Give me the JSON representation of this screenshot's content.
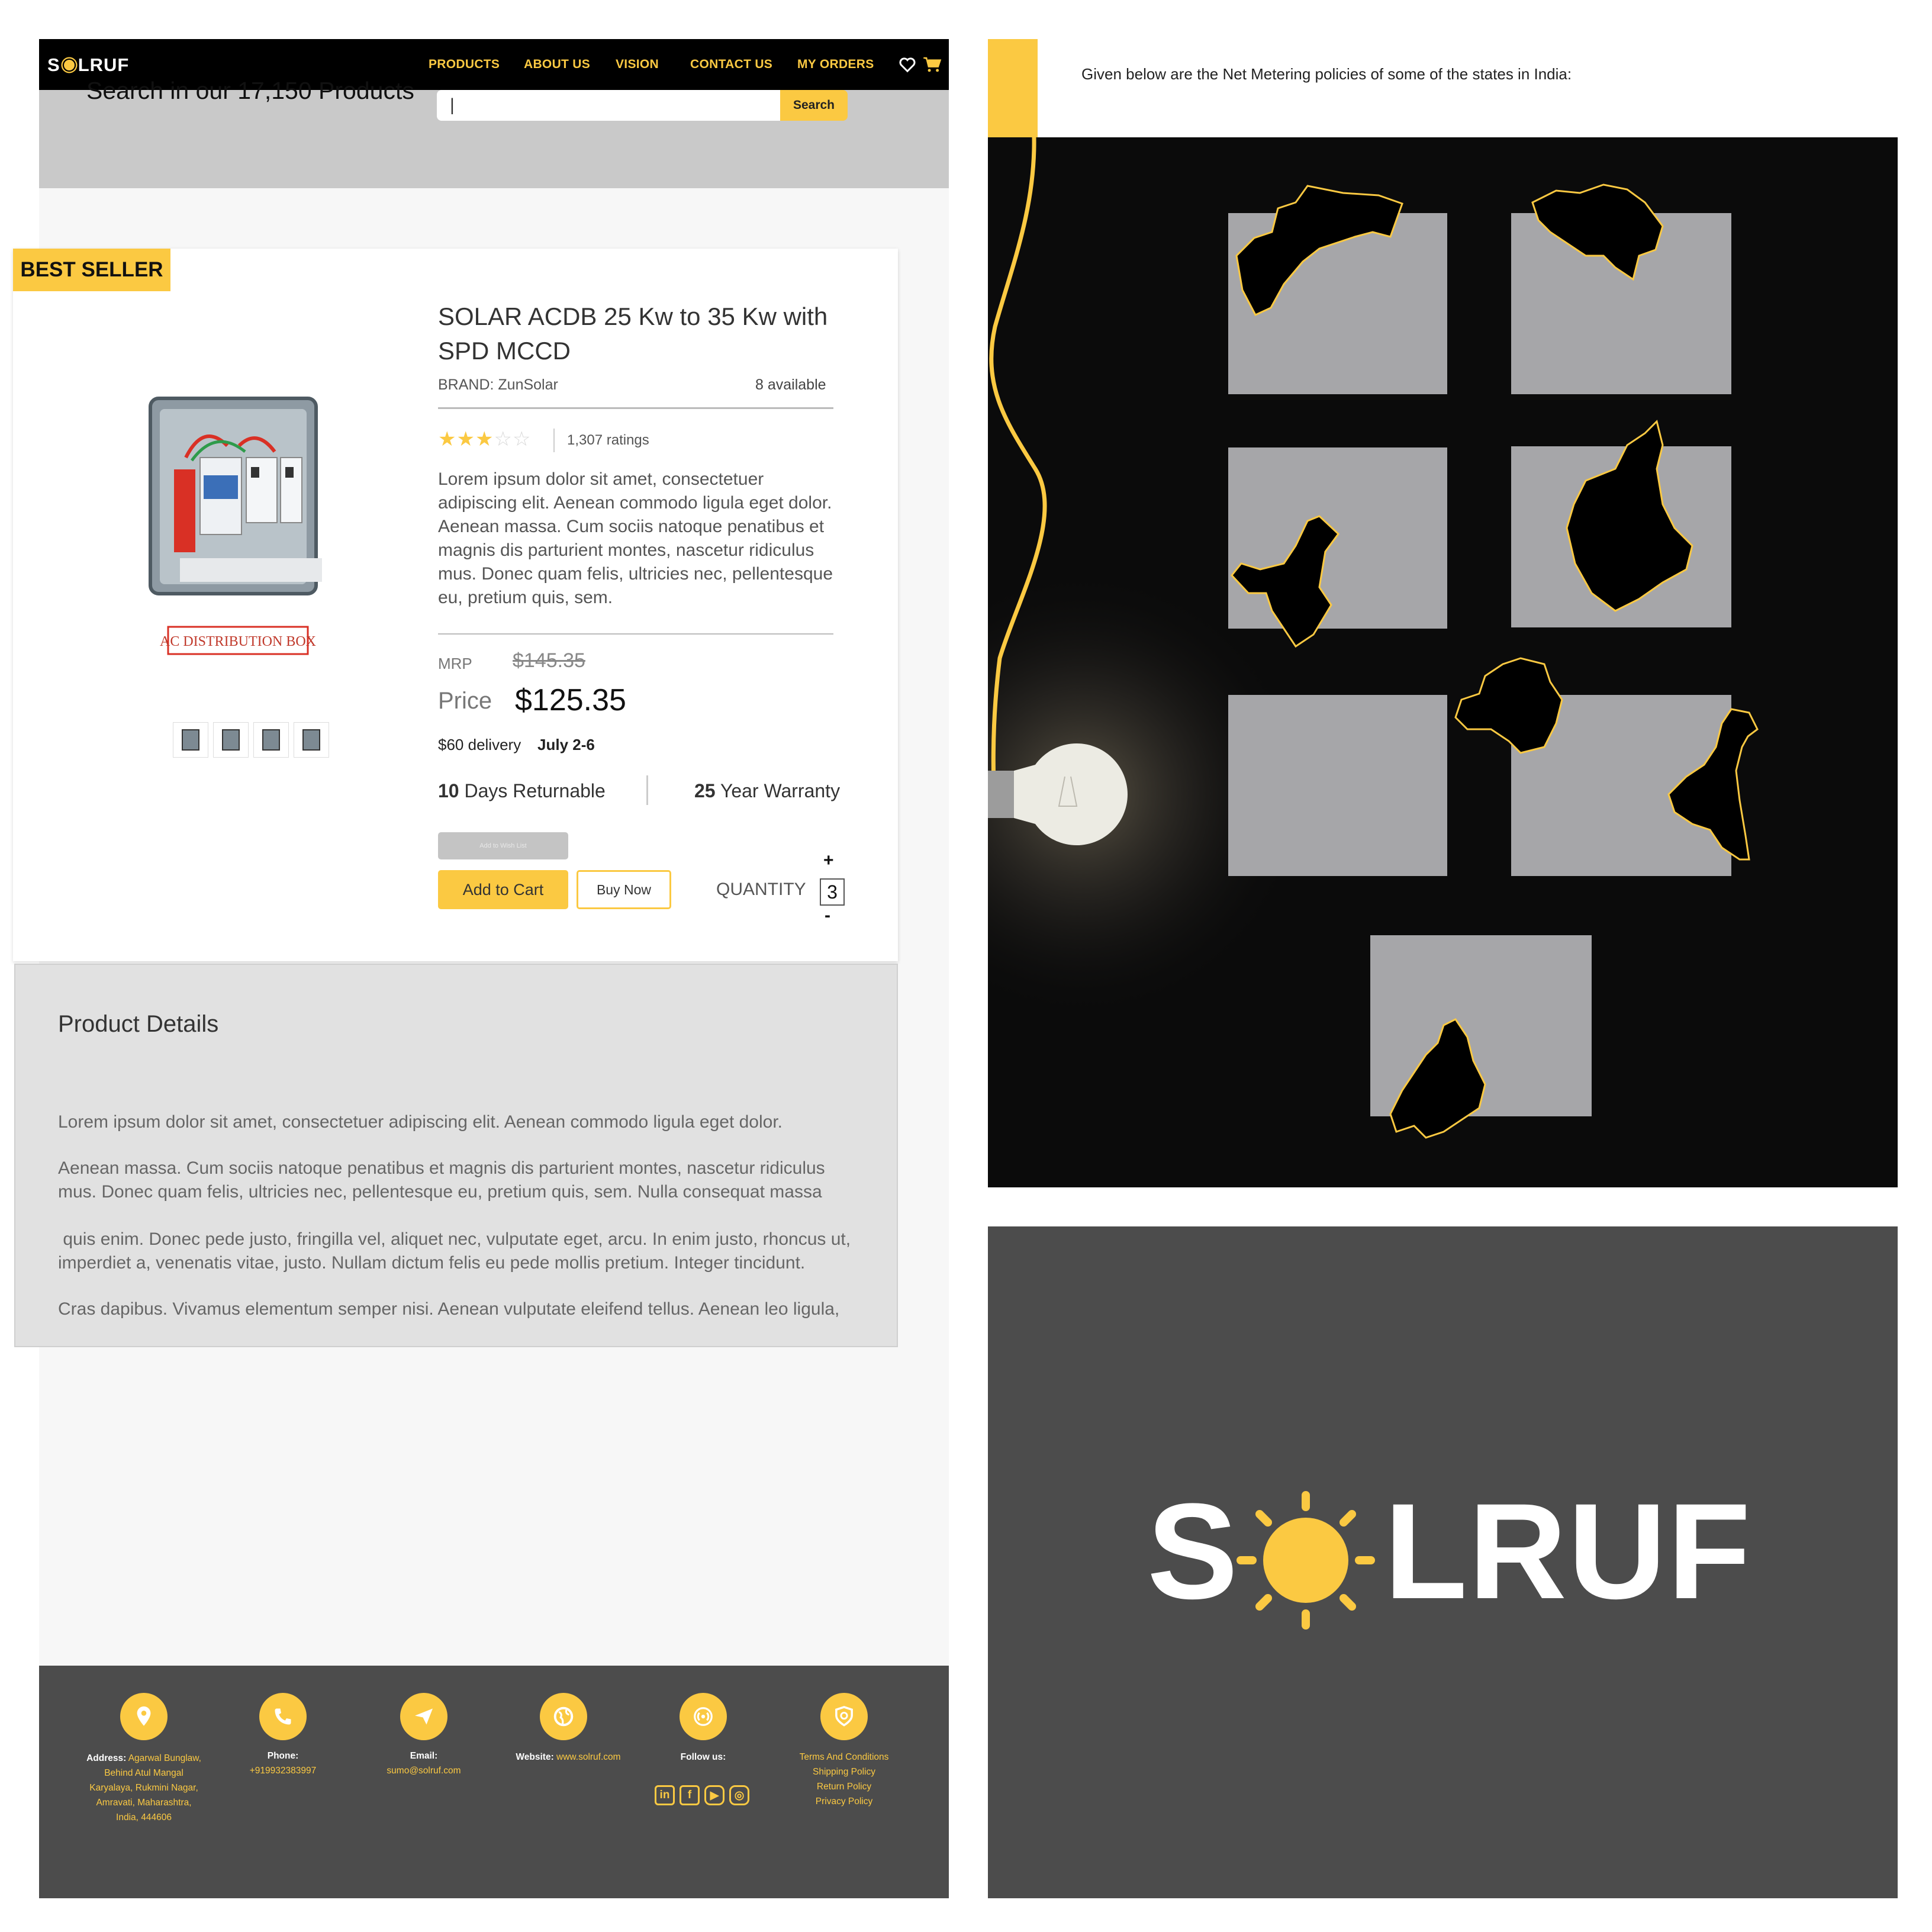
{
  "store": {
    "logo_text": "SOLRUF",
    "nav": [
      "PRODUCTS",
      "ABOUT US",
      "VISION",
      "CONTACT US",
      "MY ORDERS"
    ],
    "icons": [
      "heart-icon",
      "cart-icon"
    ],
    "search_heading": "Search in our 17,150 Products",
    "search_value": "|",
    "search_button": "Search",
    "badge": "BEST SELLER",
    "product": {
      "image_caption": "AC DISTRIBUTION BOX",
      "title": "SOLAR ACDB 25 Kw to 35 Kw with SPD MCCD",
      "brand": "BRAND: ZunSolar",
      "available": "8 available",
      "rating_stars": 3,
      "rating_max": 5,
      "ratings": "1,307 ratings",
      "description": "Lorem ipsum dolor sit amet, consectetuer adipiscing elit. Aenean commodo ligula eget dolor. Aenean massa. Cum sociis natoque penatibus et magnis dis parturient montes, nascetur ridiculus mus. Donec quam felis, ultricies nec, pellentesque eu, pretium quis, sem.",
      "mrp_label": "MRP",
      "mrp": "$145.35",
      "price_label": "Price",
      "price": "$125.35",
      "delivery": "$60 delivery",
      "delivery_date": "July 2-6",
      "return_days": "10",
      "return_text": " Days Returnable",
      "warranty_years": "25",
      "warranty_text": " Year Warranty",
      "wishlist_button": "Add to Wish List",
      "add_to_cart": "Add to Cart",
      "buy_now": "Buy Now",
      "quantity_label": "QUANTITY",
      "quantity": "3",
      "plus": "+",
      "minus": "-"
    },
    "details": {
      "title": "Product Details",
      "paragraphs": [
        "Lorem ipsum dolor sit amet, consectetuer adipiscing elit. Aenean commodo ligula eget dolor.",
        "Aenean massa. Cum sociis natoque penatibus et magnis dis parturient montes, nascetur ridiculus mus. Donec quam felis, ultricies nec, pellentesque eu, pretium quis, sem. Nulla consequat massa",
        " quis enim. Donec pede justo, fringilla vel, aliquet nec, vulputate eget, arcu. In enim justo, rhoncus ut, imperdiet a, venenatis vitae, justo. Nullam dictum felis eu pede mollis pretium. Integer tincidunt.",
        "Cras dapibus. Vivamus elementum semper nisi. Aenean vulputate eleifend tellus. Aenean leo ligula,"
      ]
    },
    "footer": {
      "address_label": "Address:",
      "address": "Agarwal Bunglaw, Behind Atul Mangal Karyalaya, Rukmini Nagar, Amravati, Maharashtra, India, 444606",
      "phone_label": "Phone:",
      "phone": "+919932383997",
      "email_label": "Email:",
      "email": "sumo@solruf.com",
      "website_label": "Website:",
      "website": "www.solruf.com",
      "follow_label": "Follow us:",
      "social": [
        "in",
        "f",
        "▶",
        "◎"
      ],
      "policies": [
        "Terms And Conditions",
        "Shipping Policy",
        "Return Policy",
        "Privacy Policy"
      ]
    }
  },
  "net_metering": {
    "intro": "Given below are the Net Metering policies of some of the states in India:"
  },
  "brand_panel": {
    "logo_text": "SOLRUF",
    "accent": "#fbc942",
    "background": "#4c4c4c"
  }
}
